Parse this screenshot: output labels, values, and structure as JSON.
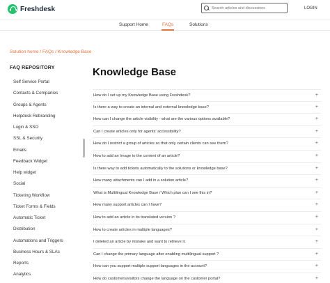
{
  "header": {
    "brand": "Freshdesk",
    "search_placeholder": "Search articles and discussions",
    "login": "LOGIN"
  },
  "nav": {
    "items": [
      "Support Home",
      "FAQs",
      "Solutions"
    ],
    "active": "FAQs"
  },
  "breadcrumb": {
    "items": [
      "Solution home",
      "FAQs",
      "Knowledge Base"
    ]
  },
  "sidebar": {
    "title": "FAQ REPOSITORY",
    "items": [
      "Self Service Portal",
      "Contacts & Companies",
      "Groups & Agents",
      "Helpdesk Rebranding",
      "Login & SSO",
      "SSL & Security",
      "Emails",
      "Feedback Widget",
      "Help widget",
      "Social",
      "Ticketing Workflow",
      "Ticket Forms & Fields",
      "Automatic Ticket",
      "Distribution",
      "Automations and Triggers",
      "Business Hours & SLAs",
      "Reports",
      "Analytics"
    ]
  },
  "main": {
    "title": "Knowledge Base",
    "questions": [
      "How do I set up my Knowledge Base using Freshdesk?",
      "Is there a way to create an internal and external knowledge base?",
      "How can I change the article visibility - what are the various options available?",
      "Can I create articles only for agents' accessibility?",
      "How do I restrict a group of articles so that only certain clients can see them?",
      "How to add an Image to the content of an article?",
      "Is there way to add tickets automatically to the solutions or knowledge base?",
      "How many attachments can I add in a solution article?",
      "What is Multilingual Knowledge Base / Which plan can I see this in?",
      "How many support articles can I have?",
      "How to add an article in its translated version ?",
      "How to create articles in multiple languages?",
      "I deleted an article by mistake and want to retrieve it.",
      "Can I change the primary language after enabling multilingual support ?",
      "How can you support multiple support languages in the account?",
      "How do customers/visitors change the language on the customer portal?"
    ],
    "expand_symbol": "+"
  },
  "colors": {
    "accent": "#e8703a",
    "brand_green": "#25c16f"
  }
}
